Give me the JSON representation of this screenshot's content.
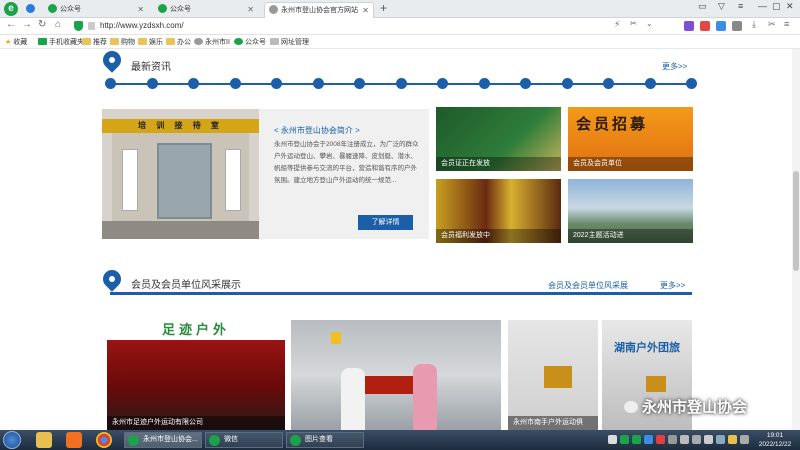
{
  "browser": {
    "tabs": [
      {
        "label": "公众号"
      },
      {
        "label": "公众号"
      },
      {
        "label": "永州市登山协会官方网站"
      }
    ],
    "url": "http://www.yzdsxh.com/",
    "bookmarks": [
      {
        "label": "收藏"
      },
      {
        "label": "手机收藏夹"
      },
      {
        "label": "推荐"
      },
      {
        "label": "购物"
      },
      {
        "label": "娱乐"
      },
      {
        "label": "办公"
      },
      {
        "label": "永州市II"
      },
      {
        "label": "公众号"
      },
      {
        "label": "网址管理"
      }
    ]
  },
  "news": {
    "title": "最新资讯",
    "more": "更多>>",
    "intro": {
      "banner": "培 训 接 待 室",
      "title": "< 永州市登山协会简介 >",
      "text": "永州市登山协会于2008年注册成立，为广泛的群众户外运动登山、攀岩、暴履速降、皮划艇、潜水、帆船等提供参与交流的平台，营造和谐有序的户外氛围。建立地方登山户外运动的统一规范...",
      "button": "了解详情"
    },
    "thumbs": [
      {
        "caption": "会员证正在发放"
      },
      {
        "caption": "会员及会员单位",
        "overlay": "会员招募"
      },
      {
        "caption": "会员福利发放中"
      },
      {
        "caption": "2022主题活动进"
      }
    ]
  },
  "showcase": {
    "title": "会员及会员单位风采展示",
    "tab": "会员及会员单位风采展",
    "more": "更多>>",
    "items": [
      {
        "caption": "永州市足迹户外运动有限公司",
        "sign": "足迹户外"
      },
      {
        "caption": ""
      },
      {
        "caption": "永州市南手户外运动俱",
        "sign": ""
      },
      {
        "caption": "",
        "sign": "湖南户外团旅"
      }
    ]
  },
  "watermark": "永州市登山协会",
  "taskbar": {
    "tasks": [
      {
        "label": "永州市登山协会..."
      },
      {
        "label": "微信"
      },
      {
        "label": "图片查看"
      }
    ],
    "time": "19:01",
    "date": "2022/12/22"
  },
  "colors": {
    "accent": "#1a5fa8",
    "brand_green": "#1aa34a"
  }
}
